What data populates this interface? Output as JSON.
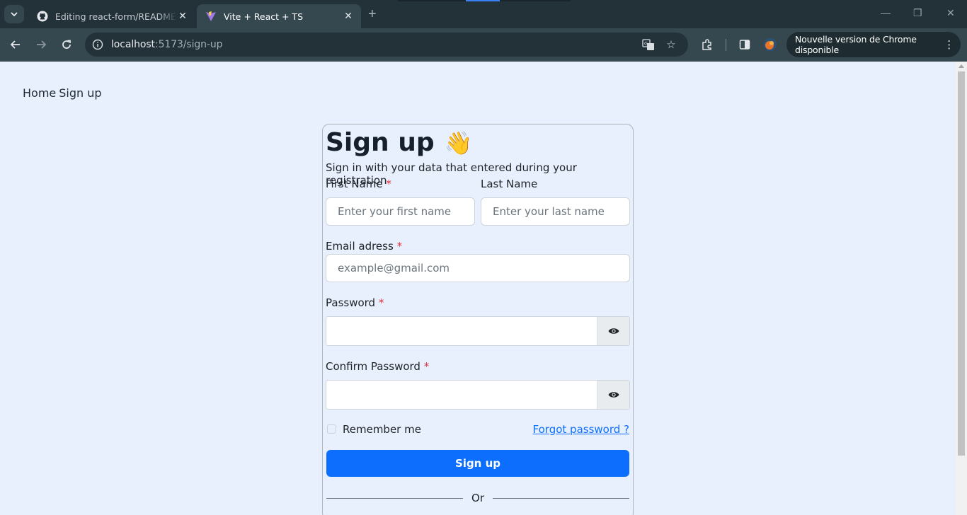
{
  "browser": {
    "tabs": [
      {
        "title": "Editing react-form/README.md",
        "active": false,
        "icon": "github-icon"
      },
      {
        "title": "Vite + React + TS",
        "active": true,
        "icon": "vite-icon"
      }
    ],
    "url_host": "localhost",
    "url_path": ":5173/sign-up",
    "update_text": "Nouvelle version de Chrome disponible",
    "accent": "#0d6efd"
  },
  "nav": {
    "home": "Home",
    "signup": "Sign up"
  },
  "form": {
    "title": "Sign up",
    "wave_emoji": "👋",
    "subtitle": "Sign in with your data that entered during your registration",
    "first_name_label": "First Name",
    "first_name_placeholder": "Enter your first name",
    "last_name_label": "Last Name",
    "last_name_placeholder": "Enter your last name",
    "email_label": "Email adress",
    "email_placeholder": "example@gmail.com",
    "password_label": "Password",
    "password_value": "",
    "confirm_label": "Confirm Password",
    "confirm_value": "",
    "required_mark": "*",
    "remember_label": "Remember me",
    "remember_checked": false,
    "forgot_label": "Forgot password ?",
    "submit_label": "Sign up",
    "divider_label": "Or"
  }
}
